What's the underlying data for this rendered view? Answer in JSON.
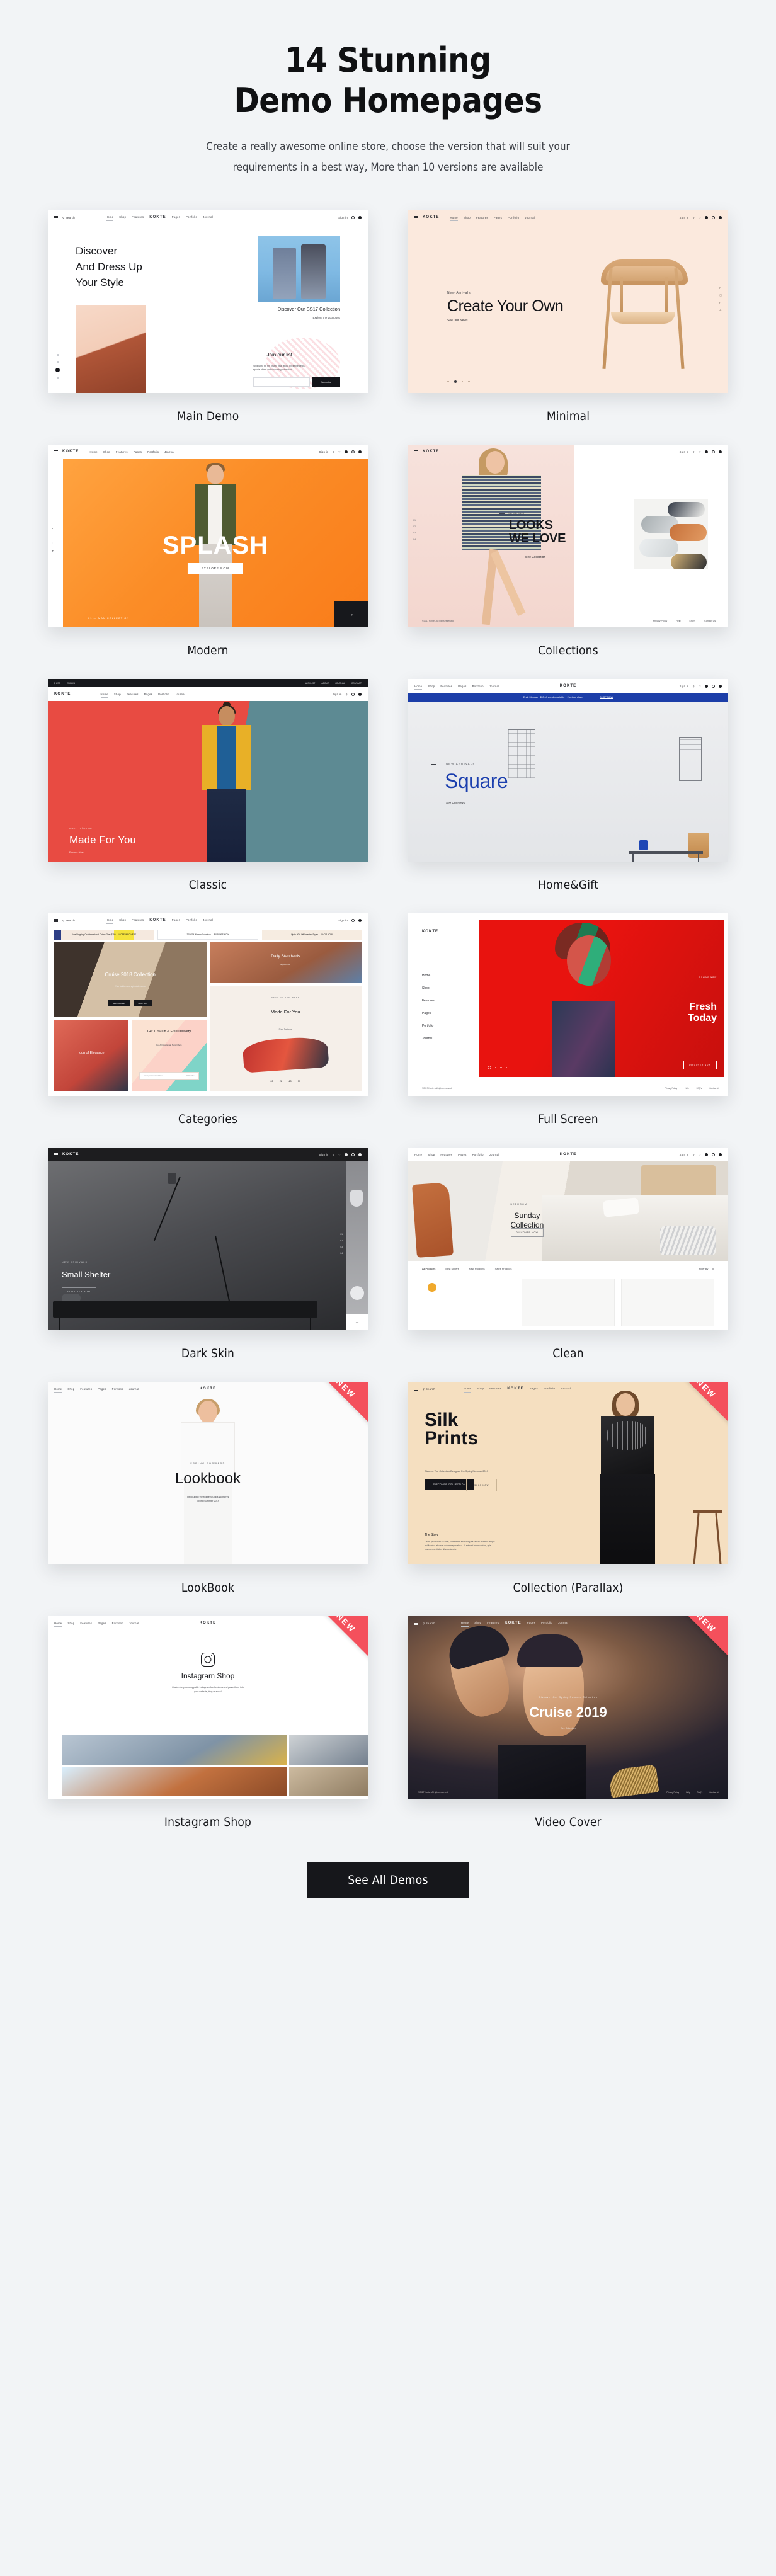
{
  "hero": {
    "title": "14 Stunning\nDemo Homepages",
    "subtitle": "Create a really awesome online store, choose the version that will suit your\nrequirements in a best way, More than 10 versions are available"
  },
  "cta": {
    "label": "See All Demos"
  },
  "badges": {
    "new": "NEW"
  },
  "colors": {
    "page_bg": "#f2f4f6",
    "ink": "#15161a",
    "ribbon_red": "#f4505c",
    "cta_bg": "#16171b",
    "splash_orange": "#fb8d27",
    "classic_red": "#e84b42",
    "square_blue": "#1b3fae",
    "fullscreen_red": "#e8130f",
    "minimal_cream": "#fbe9dd",
    "parallax_tan": "#f5dfc0"
  },
  "brand": "KOKTE",
  "common_nav": [
    "Home",
    "Shop",
    "Features",
    "Pages",
    "Portfolio",
    "Journal"
  ],
  "common_account": "Sign in",
  "search_label": "Search",
  "footer_links": [
    "Privacy Policy",
    "Help",
    "FAQ's",
    "Contact Us"
  ],
  "copyright": "©2017 Konte - All rights reserved",
  "demos": [
    {
      "id": "main-demo",
      "label": "Main Demo",
      "new": false,
      "content": {
        "heading": "Discover\nAnd Dress Up\nYour Style",
        "promo_title": "Discover Our SS17 Collection",
        "promo_link": "Explore the Lookbook",
        "newsletter_title": "Join our list",
        "newsletter_text": "Sing up to be the first to hear about exclusive deals, special offers and upcoming collections",
        "input_placeholder": "Enter your email address",
        "subscribe": "Subscribe"
      }
    },
    {
      "id": "minimal",
      "label": "Minimal",
      "new": false,
      "content": {
        "kicker": "New Arrivals",
        "heading": "Create Your Own",
        "link": "See Our News"
      }
    },
    {
      "id": "modern",
      "label": "Modern",
      "new": false,
      "content": {
        "heading": "SPLASH",
        "button": "EXPLORE NOW",
        "footer_tag": "MAN COLLECTION",
        "index": "01"
      }
    },
    {
      "id": "collections",
      "label": "Collections",
      "new": false,
      "content": {
        "kicker": "SANDALS",
        "heading": "LOOKS\nWE LOVE",
        "link": "See Collection"
      }
    },
    {
      "id": "classic",
      "label": "Classic",
      "new": false,
      "content": {
        "topbar_left": [
          "$ USD",
          "ENGLISH"
        ],
        "topbar_right": [
          "WISHLIST",
          "ABOUT",
          "JOURNAL",
          "CONTACT"
        ],
        "kicker": "Man Collection",
        "heading": "Made For You",
        "link": "Explore Now"
      }
    },
    {
      "id": "home-gift",
      "label": "Home&Gift",
      "new": false,
      "content": {
        "promo": "Endz Monday | $50 off any dining table + 2 sets of chairs",
        "promo_link": "SHOP NOW",
        "kicker": "NEW ARRIVALS",
        "heading": "Square",
        "link": "See Our News"
      }
    },
    {
      "id": "categories",
      "label": "Categories",
      "new": false,
      "content": {
        "promos": [
          "Free Shipping On International Orders Over $150",
          "20% Off Women Collection",
          "Up to 50% Off Selected Styles"
        ],
        "promo_ctas": [
          "MORE INFO HERE",
          "EXPLORE NOW",
          "SHOP NOW"
        ],
        "tile_1": "Cruise 2018 Collection",
        "tile_1_sub": "Your fashion and style statements",
        "tile_1_ctas": [
          "SHOP WOMEN",
          "SHOP MAN"
        ],
        "tile_2": "Daily Standards",
        "tile_2_sub": "Explore Now",
        "tile_3_kicker": "DEAL OF THE WEEK",
        "tile_3": "Made For You",
        "tile_3_sub": "Shop Footwear",
        "countdown": [
          "05",
          "22",
          "40",
          "37"
        ],
        "countdown_units": [
          "DAYS",
          "HOURS",
          "MINS",
          "SEC"
        ],
        "tile_4": "Icon of Elegance",
        "tile_4_sub": "Shop Bags",
        "tile_5": "Get 10% Off & Free Delivery",
        "tile_5_sub": "For All New Email Subscribers",
        "tile_5_placeholder": "Enter your email address",
        "tile_5_cta": "Subscribe"
      }
    },
    {
      "id": "full-screen",
      "label": "Full Screen",
      "new": false,
      "content": {
        "heading": "Fresh\nToday",
        "button": "DISCOVER NOW",
        "link": "ONLINE NOW"
      }
    },
    {
      "id": "dark-skin",
      "label": "Dark Skin",
      "new": false,
      "content": {
        "kicker": "NEW ARRIVALS",
        "heading": "Small Shelter",
        "button": "DISCOVER NOW"
      }
    },
    {
      "id": "clean",
      "label": "Clean",
      "new": false,
      "content": {
        "kicker": "BEDROOM",
        "heading": "Sunday\nCollection",
        "button": "DISCOVER NOW",
        "tabs": [
          "All Products",
          "Best Sellers",
          "New Products",
          "Sales Products"
        ],
        "filter": "Filter By"
      }
    },
    {
      "id": "lookbook",
      "label": "LookBook",
      "new": true,
      "content": {
        "kicker": "SPRING FORWARD",
        "heading": "Lookbook",
        "sub": "Introducing the Konte Studios Women's\nSpring/Summer 2019"
      }
    },
    {
      "id": "collection-parallax",
      "label": "Collection (Parallax)",
      "new": true,
      "content": {
        "heading": "Silk\nPrints",
        "sub": "Discover The Collection Designed For Spring/Summer 2019",
        "buttons": [
          "DISCOVER COLLECTION",
          "SHOP NOW"
        ],
        "story_title": "The Story",
        "story_text": "Lorem ipsum dolor sit amet, consectetur adipisicing elit sed do eiusmod tempor incididunt ut labore et dolore magna aliqua. Ut enim ad minim veniam, quis nostrud exercitation ullamco laboris."
      }
    },
    {
      "id": "instagram-shop",
      "label": "Instagram Shop",
      "new": true,
      "content": {
        "heading": "Instagram Shop",
        "sub": "Customise your shoppable Instagram feed embeds and paste them into\nyour website, blog or store!"
      }
    },
    {
      "id": "video-cover",
      "label": "Video Cover",
      "new": true,
      "content": {
        "kicker": "Discover Our Spring/Summer Collection",
        "heading": "Cruise 2019",
        "link": "See Collection"
      }
    }
  ]
}
